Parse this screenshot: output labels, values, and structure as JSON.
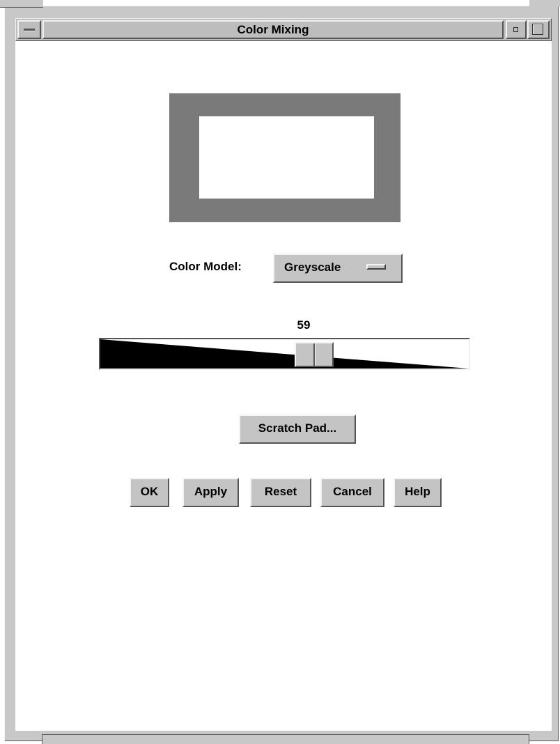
{
  "window": {
    "title": "Color Mixing"
  },
  "color_model": {
    "label": "Color Model:",
    "selected": "Greyscale"
  },
  "slider": {
    "value": "59",
    "value_number": 59,
    "min": 0,
    "max": 100
  },
  "preview": {
    "outer_color": "#7a7a7a",
    "inner_color": "#ffffff"
  },
  "buttons": {
    "scratch_pad": "Scratch Pad...",
    "ok": "OK",
    "apply": "Apply",
    "reset": "Reset",
    "cancel": "Cancel",
    "help": "Help"
  },
  "icons": {
    "window_menu": "window-menu-icon",
    "minimize": "minimize-icon",
    "maximize": "maximize-icon",
    "option_indicator": "option-menu-indicator-icon"
  }
}
